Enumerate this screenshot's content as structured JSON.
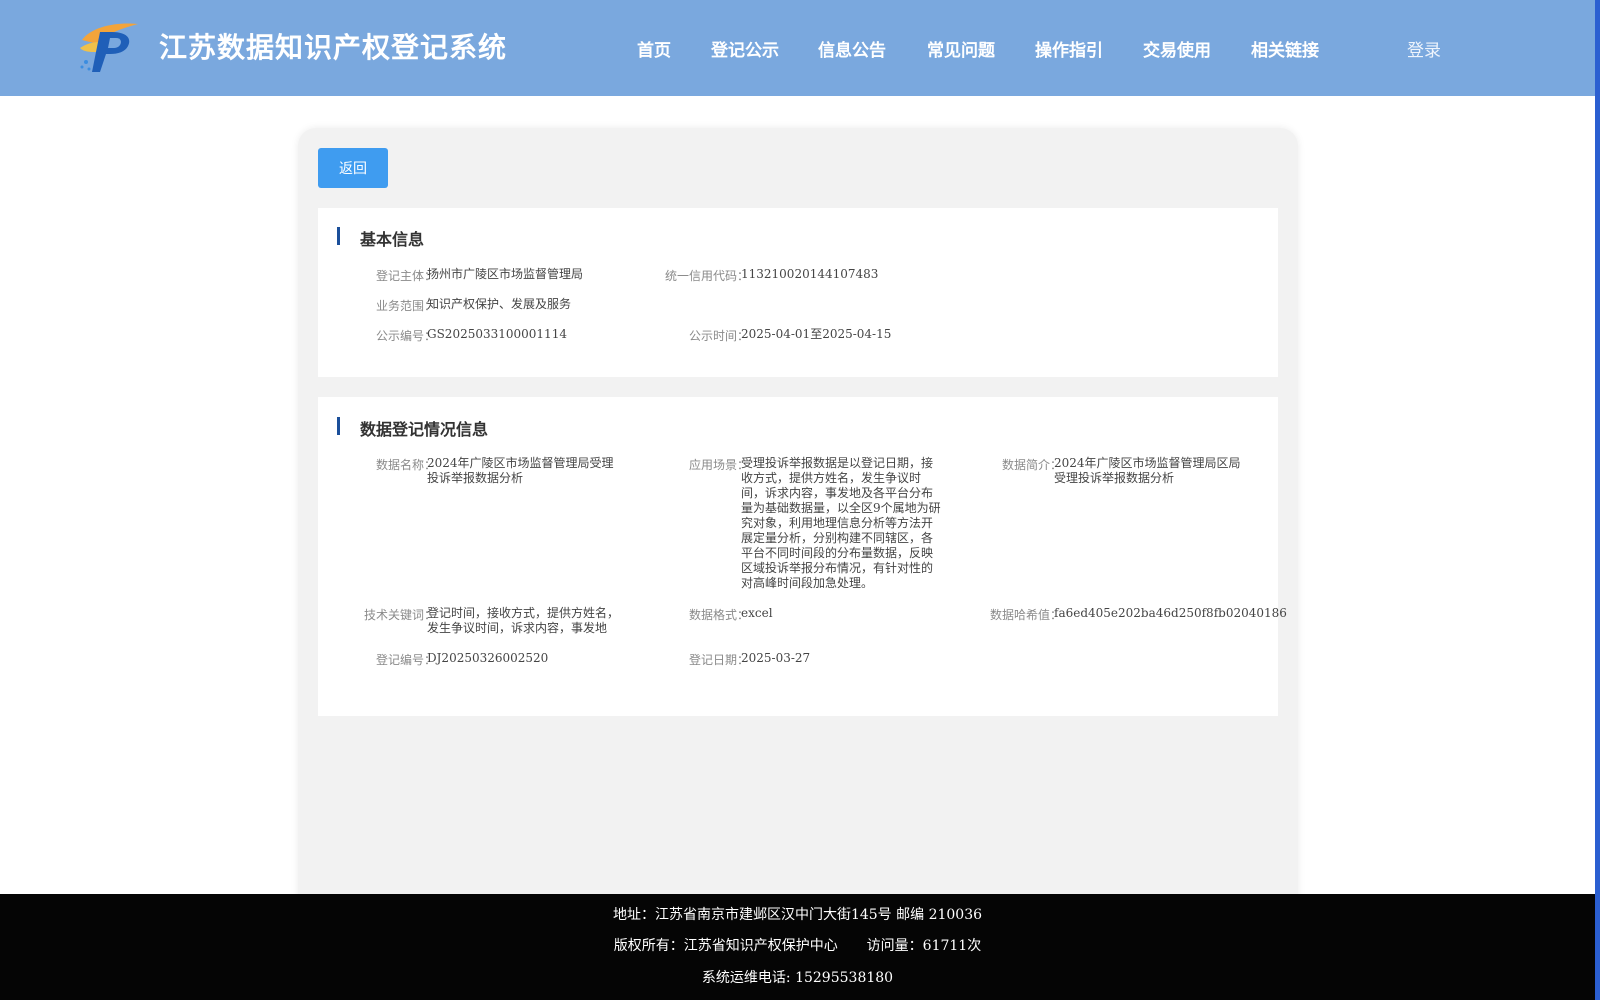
{
  "header": {
    "title": "江苏数据知识产权登记系统",
    "nav": [
      "首页",
      "登记公示",
      "信息公告",
      "常见问题",
      "操作指引",
      "交易使用",
      "相关链接"
    ],
    "login": "登录",
    "logo_icon": "ip-logo-icon"
  },
  "back_label": "返回",
  "basic": {
    "title": "基本信息",
    "subject_label": "登记主体：",
    "subject": "扬州市广陵区市场监督管理局",
    "credit_label": "统一信用代码：",
    "credit": "11321002014410748 3",
    "scope_label": "业务范围：",
    "scope": "知识产权保护、发展及服务",
    "notice_no_label": "公示编号：",
    "notice_no": "GS2025033100001114",
    "notice_time_label": "公示时间：",
    "notice_time": "2025-04-01至2025-04-15"
  },
  "data_info": {
    "title": "数据登记情况信息",
    "name_label": "数据名称：",
    "name": "2024年广陵区市场监督管理局受理投诉举报数据分析",
    "scene_label": "应用场景：",
    "scene": "受理投诉举报数据是以登记日期，接收方式，提供方姓名，发生争议时间，诉求内容，事发地及各平台分布量为基础数据量，以全区9个属地为研究对象，利用地理信息分析等方法开展定量分析，分别构建不同辖区，各平台不同时间段的分布量数据，反映区域投诉举报分布情况，有针对性的对高峰时间段加急处理。",
    "intro_label": "数据简介：",
    "intro": "2024年广陵区市场监督管理局区局受理投诉举报数据分析",
    "keywords_label": "技术关键词：",
    "keywords": "登记时间，接收方式，提供方姓名，发生争议时间，诉求内容，事发地",
    "format_label": "数据格式：",
    "format": "excel",
    "hash_label": "数据哈希值：",
    "hash": "fa6ed405e202ba46d250f8fb02040186",
    "reg_no_label": "登记编号：",
    "reg_no": "DJ20250326002520",
    "reg_date_label": "登记日期：",
    "reg_date": "2025-03-27"
  },
  "footer": {
    "address": "地址：江苏省南京市建邺区汉中门大街145号 邮编 210036",
    "copyright": "版权所有：江苏省知识产权保护中心",
    "visits": "访问量：61711次",
    "phone": "系统运维电话: 15295538180"
  }
}
